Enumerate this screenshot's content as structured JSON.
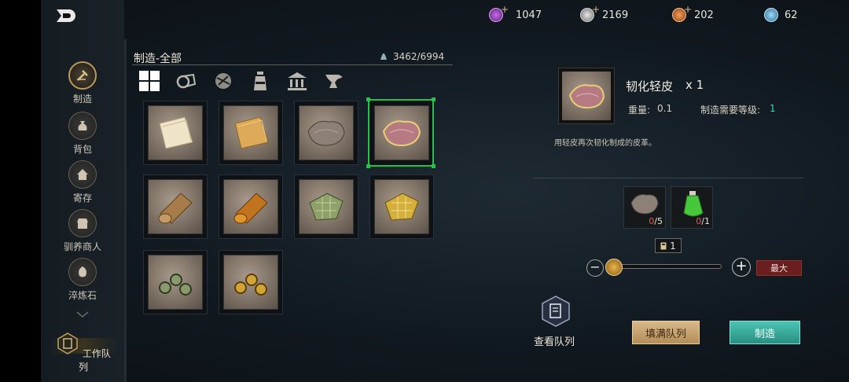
{
  "colors": {
    "accent_green": "#26c24a",
    "level_teal": "#3fd6b0",
    "craft_btn": "#2a8e82",
    "fill_btn": "#b48d58",
    "max_btn": "#6b1e1e",
    "missing_red": "#e05a4a"
  },
  "currency": [
    {
      "icon": "purple-gem-icon",
      "value": "1047"
    },
    {
      "icon": "silver-coin-icon",
      "value": "2169"
    },
    {
      "icon": "orange-token-icon",
      "value": "202"
    },
    {
      "icon": "blue-gem-icon",
      "value": "62"
    }
  ],
  "sidebar": {
    "items": [
      {
        "label": "制造",
        "icon": "hammer-icon"
      },
      {
        "label": "背包",
        "icon": "bag-icon"
      },
      {
        "label": "寄存",
        "icon": "house-icon"
      },
      {
        "label": "驯养商人",
        "icon": "shop-icon"
      },
      {
        "label": "淬炼石",
        "icon": "stone-icon"
      }
    ],
    "queue_label": "工作队列"
  },
  "craft": {
    "title": "制造-全部",
    "weight": "3462/6994",
    "tabs": [
      "all-icon",
      "leather-roll-icon",
      "ball-icon",
      "potion-icon",
      "building-icon",
      "anvil-icon"
    ]
  },
  "items": [
    {
      "name": "paper-light"
    },
    {
      "name": "paper-orange"
    },
    {
      "name": "leather-grey"
    },
    {
      "name": "leather-pink",
      "selected": true
    },
    {
      "name": "scroll-cloth"
    },
    {
      "name": "scroll-orange"
    },
    {
      "name": "mesh-green"
    },
    {
      "name": "mesh-gold"
    },
    {
      "name": "gears-green"
    },
    {
      "name": "gears-gold"
    }
  ],
  "detail": {
    "name": "韧化轻皮",
    "qty": "x 1",
    "weight_label": "重量:",
    "weight_value": "0.1",
    "level_label": "制造需要等级:",
    "level_value": "1",
    "description": "用轻皮再次韧化制成的皮革。",
    "materials": [
      {
        "icon": "leather-grey-icon",
        "have": "0",
        "need": "/5"
      },
      {
        "icon": "green-potion-icon",
        "have": "0",
        "need": "/1"
      }
    ],
    "quantity": "1",
    "max_label": "最大",
    "queue_label": "查看队列",
    "fill_label": "填满队列",
    "craft_label": "制造"
  }
}
